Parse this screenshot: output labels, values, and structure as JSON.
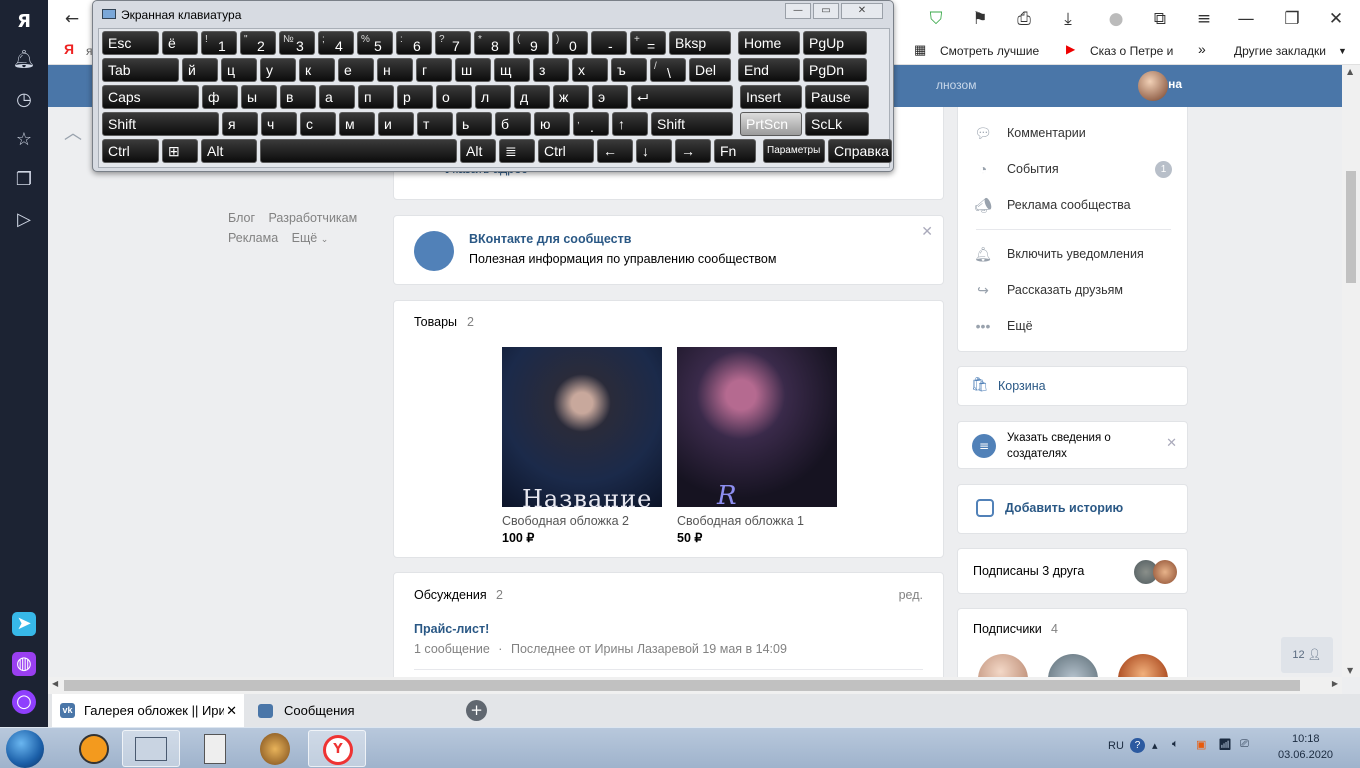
{
  "browser": {
    "bookmarks": [
      {
        "label": "Смотреть лучшие"
      },
      {
        "label": "Сказ о Петре и"
      },
      {
        "label": "Другие закладки"
      }
    ],
    "more_bookmarks": "»",
    "yandex_letter": "Я",
    "partial_bookmark_letter": "я"
  },
  "vk": {
    "user_name": "Ирина",
    "header_note": "лнозом",
    "left_links": [
      {
        "label": "Блог"
      },
      {
        "label": "Разработчикам"
      },
      {
        "label": "Реклама"
      },
      {
        "label": "Ещё"
      }
    ],
    "address_link": "Указать адрес",
    "info_card": {
      "title": "ВКонтакте для сообществ",
      "text": "Полезная информация по управлению сообществом"
    },
    "goods": {
      "title": "Товары",
      "count": "2",
      "items": [
        {
          "name": "Свободная обложка 2",
          "price": "100 ₽",
          "cover_text": "Название"
        },
        {
          "name": "Свободная обложка 1",
          "price": "50 ₽",
          "cover_text": "R"
        }
      ]
    },
    "discussions": {
      "title": "Обсуждения",
      "count": "2",
      "edit": "ред.",
      "topic_title": "Прайс-лист!",
      "topic_count": "1 сообщение",
      "separator": "·",
      "topic_last": "Последнее от Ирины Лазаревой 19 мая в 14:09"
    },
    "right_menu": [
      {
        "label": "Комментарии",
        "icon": "comment-icon"
      },
      {
        "label": "События",
        "icon": "event-icon",
        "badge": "1"
      },
      {
        "label": "Реклама сообщества",
        "icon": "megaphone-icon"
      },
      {
        "label": "Включить уведомления",
        "icon": "bell-icon"
      },
      {
        "label": "Рассказать друзьям",
        "icon": "share-icon"
      },
      {
        "label": "Ещё",
        "icon": "more-icon"
      }
    ],
    "cart": "Корзина",
    "creators": {
      "text_line1": "Указать сведения о",
      "text_line2": "создателях"
    },
    "add_story": "Добавить историю",
    "friends_subscribed": "Подписаны 3 друга",
    "subscribers": {
      "title": "Подписчики",
      "count": "4"
    },
    "online_count": "12"
  },
  "tabs": [
    {
      "label": "Галерея обложек || Ири",
      "active": true
    },
    {
      "label": "Сообщения",
      "active": false
    }
  ],
  "osk": {
    "title": "Экранная клавиатура",
    "rows": [
      [
        {
          "l": "Esc",
          "w": 57
        },
        {
          "l": "ё",
          "w": 36
        },
        {
          "t": "!",
          "l": "1",
          "w": 36
        },
        {
          "t": "\"",
          "l": "2",
          "w": 36
        },
        {
          "t": "№",
          "l": "3",
          "w": 36
        },
        {
          "t": ";",
          "l": "4",
          "w": 36
        },
        {
          "t": "%",
          "l": "5",
          "w": 36
        },
        {
          "t": ":",
          "l": "6",
          "w": 36
        },
        {
          "t": "?",
          "l": "7",
          "w": 36
        },
        {
          "t": "*",
          "l": "8",
          "w": 36
        },
        {
          "t": "(",
          "l": "9",
          "w": 36
        },
        {
          "t": ")",
          "l": "0",
          "w": 36
        },
        {
          "t": "",
          "l": "-",
          "w": 36
        },
        {
          "t": "+",
          "l": "=",
          "w": 36
        },
        {
          "l": "Bksp",
          "w": 62
        },
        {
          "l": "Home",
          "w": 62,
          "gap": 4
        },
        {
          "l": "PgUp",
          "w": 64
        }
      ],
      [
        {
          "l": "Tab",
          "w": 77
        },
        {
          "l": "й",
          "w": 36
        },
        {
          "l": "ц",
          "w": 36
        },
        {
          "l": "у",
          "w": 36
        },
        {
          "l": "к",
          "w": 36
        },
        {
          "l": "е",
          "w": 36
        },
        {
          "l": "н",
          "w": 36
        },
        {
          "l": "г",
          "w": 36
        },
        {
          "l": "ш",
          "w": 36
        },
        {
          "l": "щ",
          "w": 36
        },
        {
          "l": "з",
          "w": 36
        },
        {
          "l": "х",
          "w": 36
        },
        {
          "l": "ъ",
          "w": 36
        },
        {
          "t": "/",
          "l": "\\",
          "w": 36
        },
        {
          "l": "Del",
          "w": 42
        },
        {
          "l": "End",
          "w": 62,
          "gap": 4
        },
        {
          "l": "PgDn",
          "w": 64
        }
      ],
      [
        {
          "l": "Caps",
          "w": 97
        },
        {
          "l": "ф",
          "w": 36
        },
        {
          "l": "ы",
          "w": 36
        },
        {
          "l": "в",
          "w": 36
        },
        {
          "l": "а",
          "w": 36
        },
        {
          "l": "п",
          "w": 36
        },
        {
          "l": "р",
          "w": 36
        },
        {
          "l": "о",
          "w": 36
        },
        {
          "l": "л",
          "w": 36
        },
        {
          "l": "д",
          "w": 36
        },
        {
          "l": "ж",
          "w": 36
        },
        {
          "l": "э",
          "w": 36
        },
        {
          "l": "⮠",
          "w": 102
        },
        {
          "l": "Insert",
          "w": 62,
          "gap": 4
        },
        {
          "l": "Pause",
          "w": 64
        }
      ],
      [
        {
          "l": "Shift",
          "w": 117
        },
        {
          "l": "я",
          "w": 36
        },
        {
          "l": "ч",
          "w": 36
        },
        {
          "l": "с",
          "w": 36
        },
        {
          "l": "м",
          "w": 36
        },
        {
          "l": "и",
          "w": 36
        },
        {
          "l": "т",
          "w": 36
        },
        {
          "l": "ь",
          "w": 36
        },
        {
          "l": "б",
          "w": 36
        },
        {
          "l": "ю",
          "w": 36
        },
        {
          "t": ",",
          "l": ".",
          "w": 36
        },
        {
          "l": "↑",
          "w": 36
        },
        {
          "l": "Shift",
          "w": 82
        },
        {
          "l": "PrtScn",
          "w": 62,
          "gap": 4,
          "hl": true
        },
        {
          "l": "ScLk",
          "w": 64
        }
      ],
      [
        {
          "l": "Ctrl",
          "w": 57
        },
        {
          "l": "⊞",
          "w": 36
        },
        {
          "l": "Alt",
          "w": 56
        },
        {
          "l": "",
          "w": 197
        },
        {
          "l": "Alt",
          "w": 36
        },
        {
          "l": "≣",
          "w": 36
        },
        {
          "l": "Ctrl",
          "w": 56
        },
        {
          "l": "←",
          "w": 36
        },
        {
          "l": "↓",
          "w": 36
        },
        {
          "l": "→",
          "w": 36
        },
        {
          "l": "Fn",
          "w": 42
        },
        {
          "l": "Параметры",
          "w": 62,
          "gap": 4,
          "small": true
        },
        {
          "l": "Справка",
          "w": 64
        }
      ]
    ]
  },
  "tray": {
    "lang": "RU",
    "time": "10:18",
    "date": "03.06.2020"
  },
  "colors": {
    "vk_blue": "#4a76a8",
    "link": "#2a5885",
    "page_bg": "#edeef0"
  }
}
